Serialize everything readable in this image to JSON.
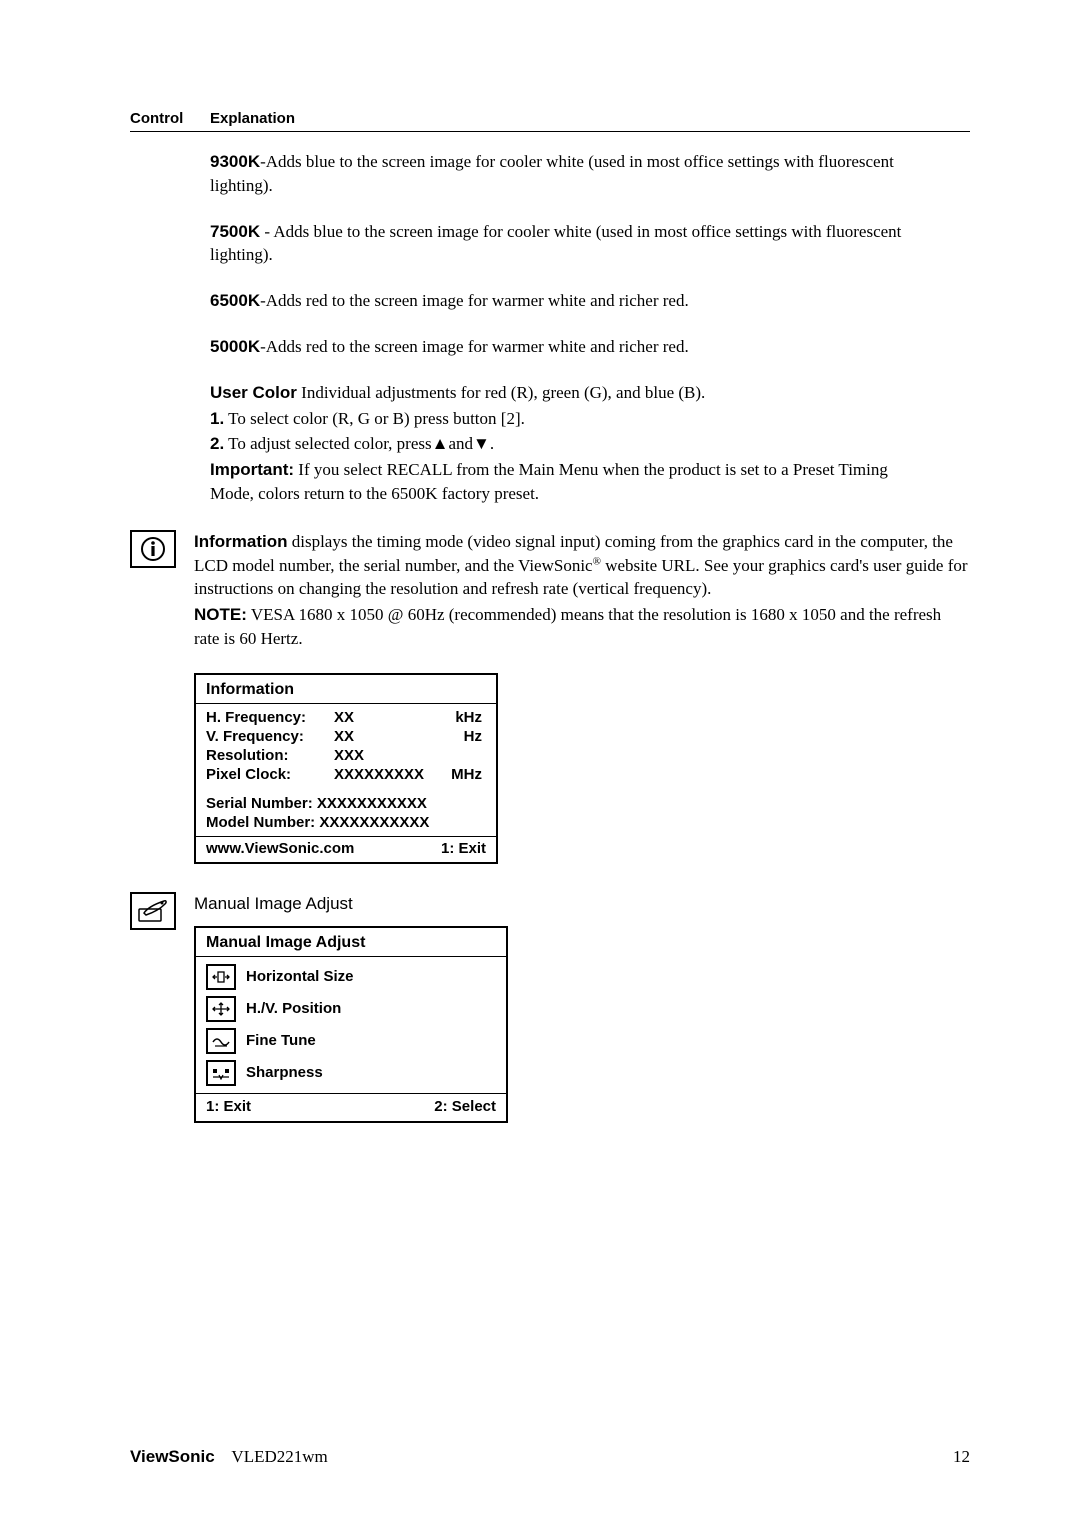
{
  "header": {
    "control": "Control",
    "explanation": "Explanation"
  },
  "k9300": {
    "label": "9300K",
    "dash": "-",
    "text": "Adds blue to the screen image for cooler white (used in most office settings with fluorescent lighting)."
  },
  "k7500": {
    "label": "7500K",
    "dash": " - ",
    "text": "Adds blue to the screen image for cooler white (used in most office settings with fluorescent lighting)."
  },
  "k6500": {
    "label": "6500K",
    "dash": "-",
    "text": "Adds red to the screen image for warmer white and richer red."
  },
  "k5000": {
    "label": "5000K",
    "dash": "-",
    "text": "Adds red to the screen image for warmer white and richer red."
  },
  "usercolor": {
    "label": "User Color",
    "text": " Individual adjustments for red (R), green (G),  and blue (B)."
  },
  "step1": {
    "label": "1.",
    "text": " To select color (R, G or B) press button [2]."
  },
  "step2": {
    "label": "2.",
    "text_a": " To adjust selected color, press",
    "up": "▲",
    "mid": "and",
    "down": "▼",
    "end": "."
  },
  "important": {
    "label": "Important:",
    "text": "  If you select RECALL from the Main Menu when the product is set to a Preset Timing Mode, colors return to the 6500K factory preset."
  },
  "info": {
    "label": "Information",
    "text1": "  displays the timing mode (video signal input) coming from the graphics card in the computer, the LCD model number, the serial number, and the ViewSonic",
    "reg": "®",
    "text2": " website URL. See your graphics card's user guide for instructions on changing the resolution and refresh rate (vertical frequency).",
    "note_label": "NOTE:",
    "note_text": " VESA 1680 x 1050 @ 60Hz (recommended) means that the resolution is 1680 x 1050 and the refresh rate is 60 Hertz."
  },
  "osd_info": {
    "title": "Information",
    "rows": [
      {
        "c1": "H. Frequency:",
        "c2": "XX",
        "c3": "kHz"
      },
      {
        "c1": "V. Frequency:",
        "c2": "XX",
        "c3": "Hz"
      },
      {
        "c1": "Resolution:",
        "c2": "XXX",
        "c3": ""
      },
      {
        "c1": "Pixel Clock:",
        "c2": "XXXXXXXXX",
        "c3": "MHz"
      }
    ],
    "serial": "Serial Number:  XXXXXXXXXXX",
    "model": "Model Number: XXXXXXXXXXX",
    "url": "www.ViewSonic.com",
    "exit": "1: Exit"
  },
  "mia": {
    "heading": "Manual Image Adjust",
    "title": "Manual Image Adjust",
    "items": [
      "Horizontal Size",
      "H./V. Position",
      "Fine Tune",
      "Sharpness"
    ],
    "exit": "1: Exit",
    "select": "2: Select"
  },
  "footer": {
    "brand": "ViewSonic",
    "model": "VLED221wm",
    "page": "12"
  }
}
